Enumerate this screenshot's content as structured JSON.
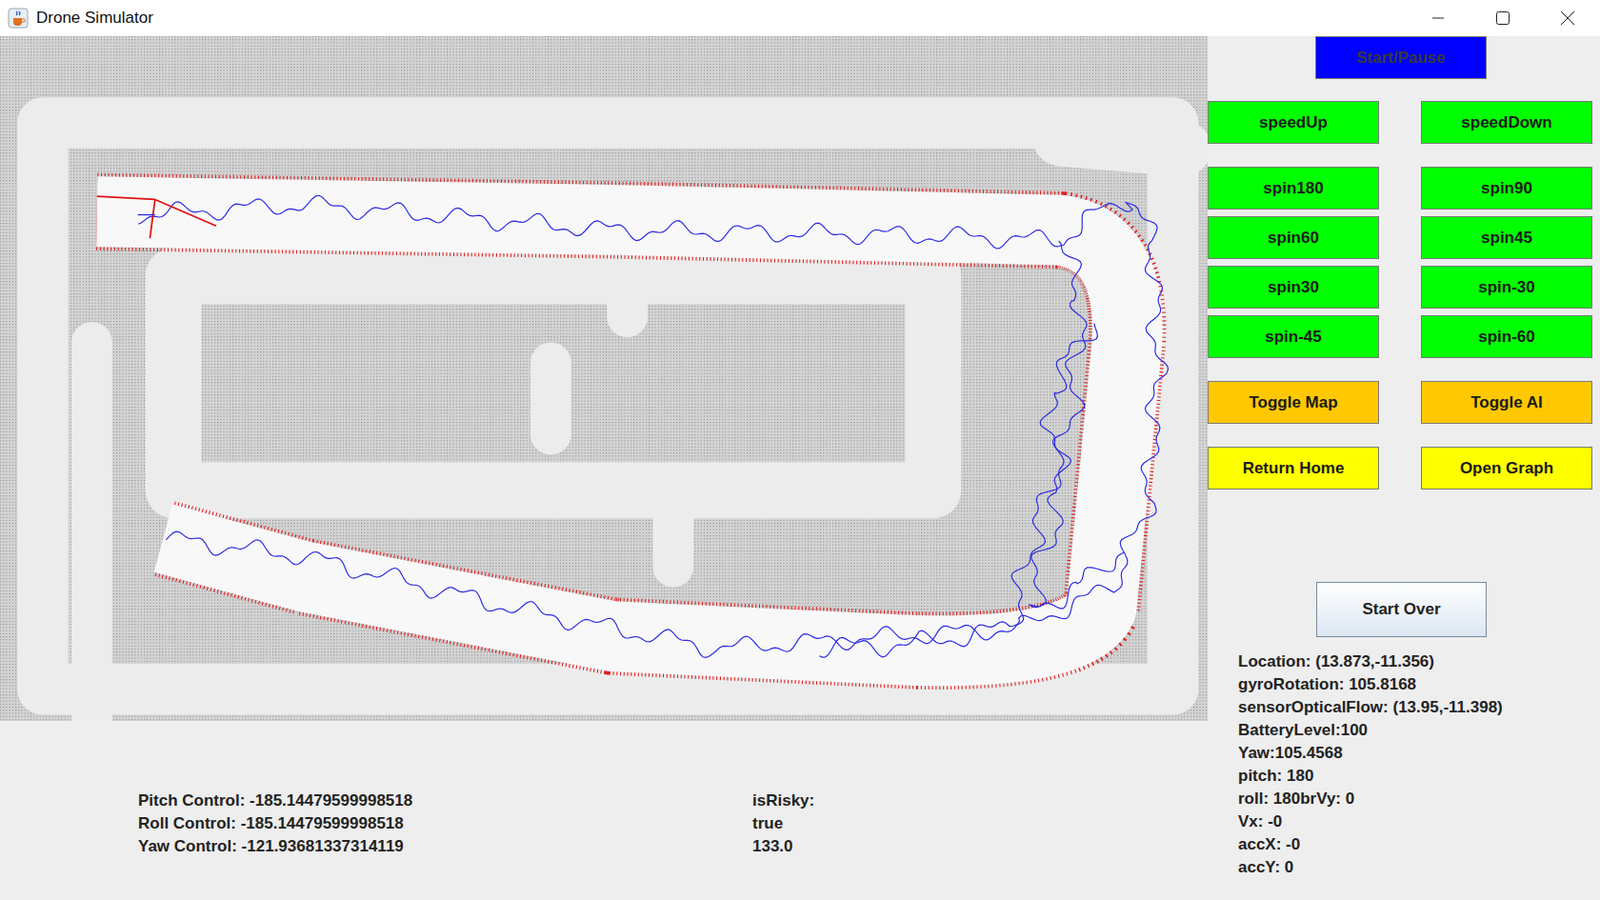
{
  "window": {
    "title": "Drone Simulator"
  },
  "controls": {
    "start_pause": {
      "label": "Start/Pause",
      "color": "#0000ff"
    },
    "button_groups": [
      [
        {
          "label": "speedUp",
          "color": "#00ff00"
        },
        {
          "label": "speedDown",
          "color": "#00ff00"
        }
      ],
      [
        {
          "label": "spin180",
          "color": "#00ff00"
        },
        {
          "label": "spin90",
          "color": "#00ff00"
        },
        {
          "label": "spin60",
          "color": "#00ff00"
        },
        {
          "label": "spin45",
          "color": "#00ff00"
        },
        {
          "label": "spin30",
          "color": "#00ff00"
        },
        {
          "label": "spin-30",
          "color": "#00ff00"
        },
        {
          "label": "spin-45",
          "color": "#00ff00"
        },
        {
          "label": "spin-60",
          "color": "#00ff00"
        }
      ],
      [
        {
          "label": "Toggle Map",
          "color": "#ffc800"
        },
        {
          "label": "Toggle AI",
          "color": "#ffc800"
        }
      ],
      [
        {
          "label": "Return Home",
          "color": "#ffff00"
        },
        {
          "label": "Open Graph",
          "color": "#ffff00"
        }
      ]
    ],
    "start_over": {
      "label": "Start Over"
    }
  },
  "control_outputs": [
    "Pitch Control: -185.14479599998518",
    "Roll Control: -185.14479599998518",
    "Yaw Control: -121.93681337314119"
  ],
  "risk": [
    "isRisky:",
    "true",
    "133.0"
  ],
  "telemetry": [
    "Location: (13.873,-11.356)",
    "gyroRotation: 105.8168",
    "sensorOpticalFlow: (13.95,-11.398)",
    "BatteryLevel:100",
    "Yaw:105.4568",
    "pitch: 180",
    "roll: 180brVy: 0",
    "Vx: -0",
    "accX: -0",
    "accY: 0"
  ]
}
